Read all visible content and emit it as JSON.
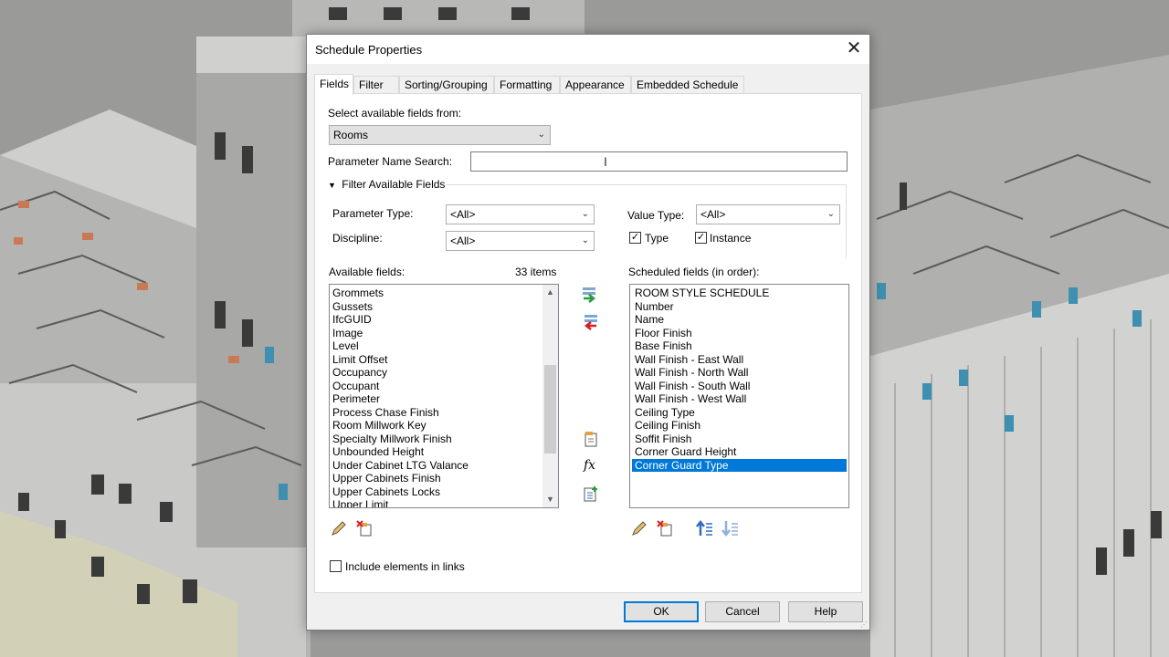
{
  "dialog": {
    "title": "Schedule Properties",
    "tabs": [
      {
        "label": "Fields",
        "active": true
      },
      {
        "label": "Filter",
        "active": false
      },
      {
        "label": "Sorting/Grouping",
        "active": false
      },
      {
        "label": "Formatting",
        "active": false
      },
      {
        "label": "Appearance",
        "active": false
      },
      {
        "label": "Embedded Schedule",
        "active": false
      }
    ],
    "select_fields_label": "Select available fields from:",
    "select_fields_value": "Rooms",
    "param_search_label": "Parameter Name Search:",
    "param_search_value": "",
    "filter_header": "Filter Available Fields",
    "parameter_type_label": "Parameter Type:",
    "parameter_type_value": "<All>",
    "discipline_label": "Discipline:",
    "discipline_value": "<All>",
    "value_type_label": "Value Type:",
    "value_type_value": "<All>",
    "type_checkbox": {
      "label": "Type",
      "checked": true
    },
    "instance_checkbox": {
      "label": "Instance",
      "checked": true
    },
    "available_label": "Available fields:",
    "available_count": "33 items",
    "available_fields": [
      "Grommets",
      "Gussets",
      "IfcGUID",
      "Image",
      "Level",
      "Limit Offset",
      "Occupancy",
      "Occupant",
      "Perimeter",
      "Process Chase Finish",
      "Room Millwork Key",
      "Specialty Millwork Finish",
      "Unbounded Height",
      "Under Cabinet LTG Valance",
      "Upper Cabinets Finish",
      "Upper Cabinets Locks",
      "Upper Limit"
    ],
    "scheduled_label": "Scheduled fields (in order):",
    "scheduled_fields": [
      "ROOM STYLE SCHEDULE",
      "Number",
      "Name",
      "Floor Finish",
      "Base Finish",
      "Wall Finish - East Wall",
      "Wall Finish - North Wall",
      "Wall Finish - South Wall",
      "Wall Finish - West Wall",
      "Ceiling Type",
      "Ceiling Finish",
      "Soffit Finish",
      "Corner Guard Height",
      "Corner Guard Type"
    ],
    "scheduled_selected_index": 13,
    "include_links": {
      "label": "Include elements in links",
      "checked": false
    },
    "buttons": {
      "ok": "OK",
      "cancel": "Cancel",
      "help": "Help"
    },
    "accent_color": "#0078d7"
  }
}
